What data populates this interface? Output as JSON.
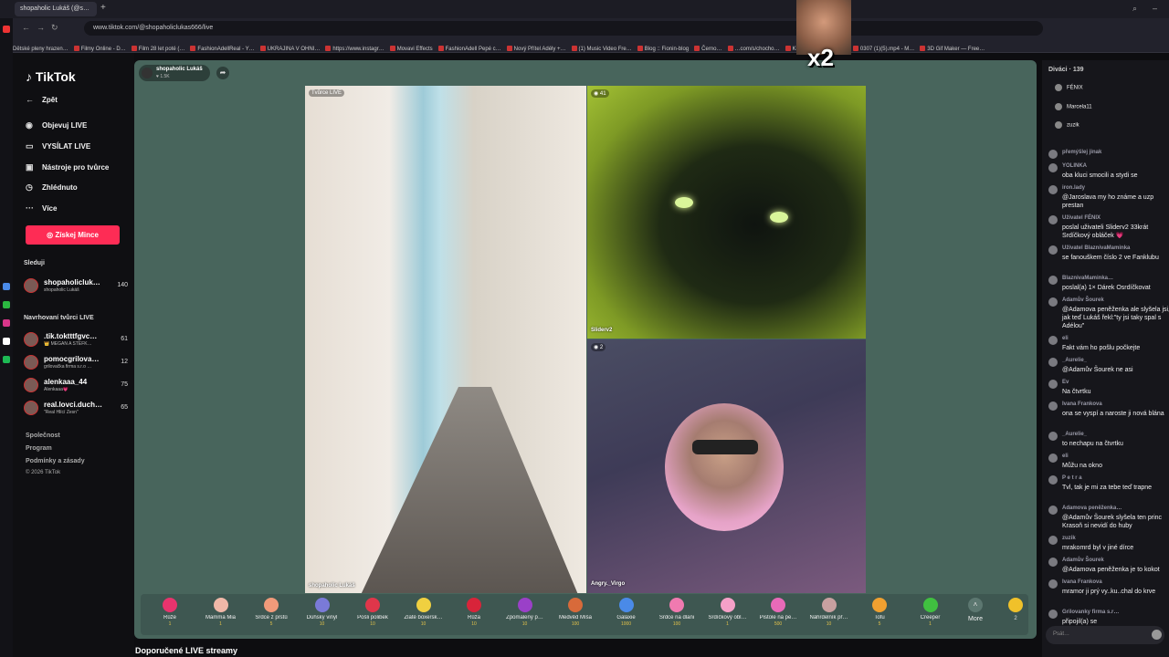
{
  "browser": {
    "tab_title": "shopaholic Lukáš (@s…",
    "url": "www.tiktok.com/@shopaholiclukas666/live",
    "bookmarks": [
      "Dětské pleny hrazen…",
      "Filmy Online - D…",
      "Film 28 let poté (…",
      "FashionAdellReal - Y…",
      "UKRAJINA V OHNI…",
      "https://www.instagr…",
      "Movavi Effects",
      "FashionAdell Pepé c…",
      "Nový Přítel Adély +…",
      "(1) Music Video Fre…",
      "Blog :: Fionin-blog",
      "Černo…",
      "…com/s/chocho…",
      "Kick VOD Download…",
      "0307 (1)(5).mp4 - M…",
      "3D Gif Maker — Free…"
    ]
  },
  "overlay": {
    "multiplier": "x2"
  },
  "sidebar": {
    "logo": "TikTok",
    "back": "Zpět",
    "nav": [
      "Objevuj LIVE",
      "VYSÍLAT LIVE",
      "Nástroje pro tvůrce",
      "Zhlédnuto",
      "Více"
    ],
    "coins_button": "Získej Mince",
    "following_title": "Sleduji",
    "following": [
      {
        "name": "shopaholicluk…",
        "sub": "shopaholic Lukáš",
        "count": "140"
      }
    ],
    "suggested_title": "Navrhovaní tvůrci LIVE",
    "suggested": [
      {
        "name": ".tik.toktttfgvc…",
        "sub": "👑 MEGAN A ŠTEFK…",
        "count": "61"
      },
      {
        "name": "pomocgrilova…",
        "sub": "grilovačka firma s.r.o …",
        "count": "12"
      },
      {
        "name": "alenkaaa_44",
        "sub": "Alenkaaa💗",
        "count": "75"
      },
      {
        "name": "real.lovci.duch…",
        "sub": "\"Real Hlící Zesn\"",
        "count": "65"
      }
    ],
    "footer": [
      "Společnost",
      "Program",
      "Podmínky a zásady",
      "© 2026 TikTok"
    ]
  },
  "live": {
    "host_name": "shopaholic Lukáš",
    "host_likes": "♥ 1.5K",
    "pane1_badge": "Tvůrce LIVE",
    "pane1_name": "shopaholic Lukáš",
    "pane2_count": "41",
    "pane2_name": "Sliderv2",
    "pane3_count": "2",
    "pane3_name": "Angry._Virgo"
  },
  "gifts": [
    {
      "name": "Růže",
      "price": "1",
      "color": "#e8336d"
    },
    {
      "name": "Mamma Mia",
      "price": "1",
      "color": "#f0b8a8"
    },
    {
      "name": "Srdce z prstů",
      "price": "5",
      "color": "#f09a7a"
    },
    {
      "name": "Dúhský vinyl",
      "price": "10",
      "color": "#7a7ad8"
    },
    {
      "name": "Pošli polibek",
      "price": "10",
      "color": "#e0364a"
    },
    {
      "name": "Zlaté boxersk…",
      "price": "10",
      "color": "#f0d040"
    },
    {
      "name": "Růža",
      "price": "10",
      "color": "#d8243a"
    },
    {
      "name": "Zpomalený p…",
      "price": "10",
      "color": "#9a40c8"
    },
    {
      "name": "Medvěd Míša",
      "price": "100",
      "color": "#d86a3a"
    },
    {
      "name": "Galaxie",
      "price": "1000",
      "color": "#4a8ae8"
    },
    {
      "name": "Srdce na dlani",
      "price": "100",
      "color": "#f07ab0"
    },
    {
      "name": "Srdíčkový obl…",
      "price": "1",
      "color": "#f5a0c8"
    },
    {
      "name": "Pistole na pe…",
      "price": "500",
      "color": "#e86ab8"
    },
    {
      "name": "Náhrdelník př…",
      "price": "10",
      "color": "#c8a0a0"
    },
    {
      "name": "Tofu",
      "price": "5",
      "color": "#f0a030"
    },
    {
      "name": "Creeper",
      "price": "1",
      "color": "#40c040"
    }
  ],
  "gifts_more": "Více",
  "gifts_more_en": "More",
  "coin_count": "2",
  "recommended_title": "Doporučené LIVE streamy",
  "chat": {
    "viewers_title": "Diváci · 139",
    "top_viewers": [
      "FÉNIX",
      "Marcela11",
      "zuzik"
    ],
    "messages": [
      {
        "user": "přemýšlej jinak",
        "text": ""
      },
      {
        "user": "YOLINKA",
        "text": "oba kluci smocili a stydi se"
      },
      {
        "user": "iron.lady",
        "text": "@Jaroslava my ho známe a uzp prestan"
      },
      {
        "user": "Uživatel FÉNIX",
        "text": "poslal uživateli Sliderv2 33krát Srdíčkový obláček 💗"
      },
      {
        "user": "Uživatel BlaznivaMaminka",
        "text": "se fanouškem číslo 2 ve Fanklubu"
      },
      {
        "user": "BlaznivaMaminka…",
        "text": "poslal(a) 1× Dárek Osrdíčkovat"
      },
      {
        "user": "Adamův Šourek",
        "text": "@Adamova peněženka ale slyšela jsi, jak teď Lukáš řekl:\"ty jsi taky spal s Adélou\""
      },
      {
        "user": "eli",
        "text": "Fakt vám ho pošlu počkejte"
      },
      {
        "user": "_Aurelie_",
        "text": "@Adamův Šourek ne asi"
      },
      {
        "user": "Ev",
        "text": "Na čtvrtku"
      },
      {
        "user": "Ivana Frankova",
        "text": "ona se vyspí a naroste ji nová blána"
      },
      {
        "user": "_Aurelie_",
        "text": "to nechapu na čtvrtku"
      },
      {
        "user": "eli",
        "text": "Můžu na okno"
      },
      {
        "user": "P e t r a",
        "text": "Tvl, tak je mi za tebe teď trapne"
      },
      {
        "user": "Adamova peněženka…",
        "text": "@Adamův Šourek slyšela ten princ Krasoň si nevidí do huby"
      },
      {
        "user": "zuzik",
        "text": "mrakomrd byl v jiné dírce"
      },
      {
        "user": "Adamův Šourek",
        "text": "@Adamova peněženka je to kokot"
      },
      {
        "user": "Ivana Frankova",
        "text": "mramor ji prý vy..ku..chal do krve"
      },
      {
        "user": "Grilovanky firma s.r…",
        "text": "připojil(a) se"
      }
    ],
    "input_placeholder": "Psát…"
  }
}
